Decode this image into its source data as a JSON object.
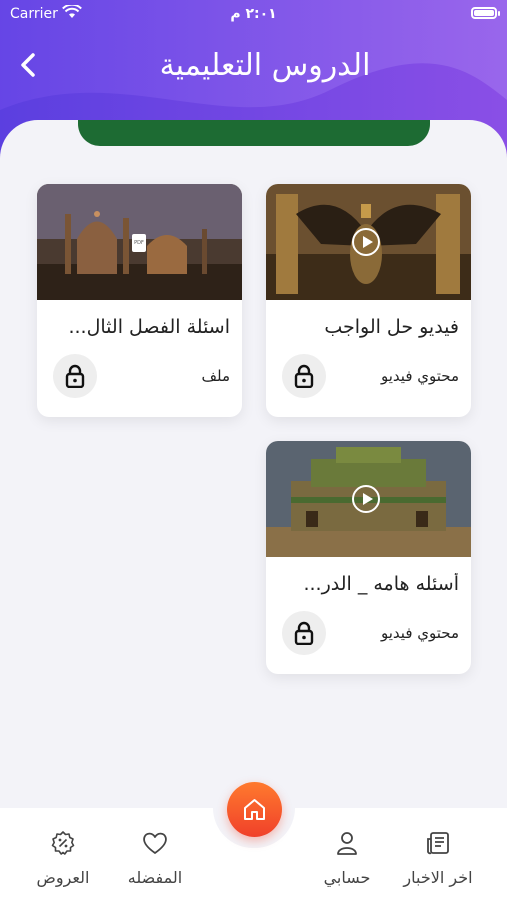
{
  "status_bar": {
    "carrier": "Carrier",
    "time": "٢:٠١ م"
  },
  "header": {
    "title": "الدروس التعليمية"
  },
  "banner": {
    "text": "..."
  },
  "colors": {
    "header_start": "#5b3fe0",
    "header_end": "#8a4fe6",
    "accent_green": "#1d6b33",
    "fab_start": "#ff7a2e",
    "fab_end": "#f0402a"
  },
  "cards": [
    {
      "title": "فيديو حل الواجب",
      "type": "محتوي فيديو",
      "kind": "video",
      "icon": "lock-icon"
    },
    {
      "title": "اسئلة الفصل الثال...",
      "type": "ملف",
      "kind": "file",
      "icon": "lock-icon"
    },
    {
      "title": "أسئله هامه _ الدر...",
      "type": "محتوي فيديو",
      "kind": "video",
      "icon": "lock-icon"
    }
  ],
  "tabs": {
    "news": "اخر الاخبار",
    "account": "حسابي",
    "favorites": "المفضله",
    "offers": "العروض"
  }
}
